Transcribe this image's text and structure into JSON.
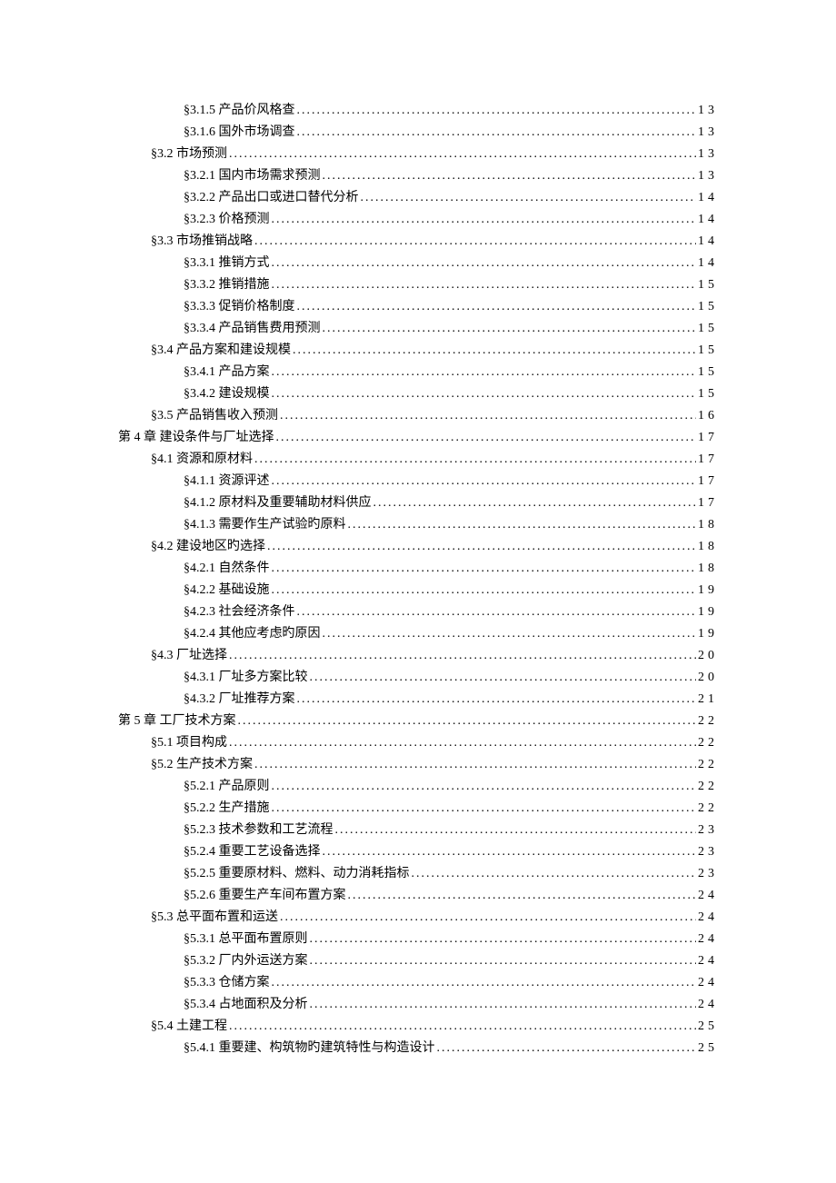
{
  "toc": {
    "entries": [
      {
        "level": 3,
        "label": "§3.1.5  产品价风格查",
        "page": "13"
      },
      {
        "level": 3,
        "label": "§3.1.6  国外市场调查",
        "page": "13"
      },
      {
        "level": 2,
        "label": "§3.2  市场预测",
        "page": "13"
      },
      {
        "level": 3,
        "label": "§3.2.1  国内市场需求预测",
        "page": "13"
      },
      {
        "level": 3,
        "label": "§3.2.2  产品出口或进口替代分析",
        "page": "14"
      },
      {
        "level": 3,
        "label": "§3.2.3  价格预测",
        "page": "14"
      },
      {
        "level": 2,
        "label": "§3.3  市场推销战略",
        "page": "14"
      },
      {
        "level": 3,
        "label": "§3.3.1  推销方式",
        "page": "14"
      },
      {
        "level": 3,
        "label": "§3.3.2  推销措施",
        "page": "15"
      },
      {
        "level": 3,
        "label": "§3.3.3  促销价格制度",
        "page": "15"
      },
      {
        "level": 3,
        "label": "§3.3.4  产品销售费用预测",
        "page": "15"
      },
      {
        "level": 2,
        "label": "§3.4  产品方案和建设规模",
        "page": "15"
      },
      {
        "level": 3,
        "label": "§3.4.1  产品方案",
        "page": "15"
      },
      {
        "level": 3,
        "label": "§3.4.2  建设规模",
        "page": "15"
      },
      {
        "level": 2,
        "label": "§3.5  产品销售收入预测",
        "page": "16"
      },
      {
        "level": 1,
        "label": "第 4 章  建设条件与厂址选择",
        "page": "17"
      },
      {
        "level": 2,
        "label": "§4.1  资源和原材料",
        "page": "17"
      },
      {
        "level": 3,
        "label": "§4.1.1  资源评述",
        "page": "17"
      },
      {
        "level": 3,
        "label": "§4.1.2  原材料及重要辅助材料供应",
        "page": "17"
      },
      {
        "level": 3,
        "label": "§4.1.3  需要作生产试验旳原料",
        "page": "18"
      },
      {
        "level": 2,
        "label": "§4.2  建设地区旳选择",
        "page": "18"
      },
      {
        "level": 3,
        "label": "§4.2.1  自然条件",
        "page": "18"
      },
      {
        "level": 3,
        "label": "§4.2.2  基础设施",
        "page": "19"
      },
      {
        "level": 3,
        "label": "§4.2.3  社会经济条件",
        "page": "19"
      },
      {
        "level": 3,
        "label": "§4.2.4  其他应考虑旳原因",
        "page": "19"
      },
      {
        "level": 2,
        "label": "§4.3  厂址选择",
        "page": "20"
      },
      {
        "level": 3,
        "label": "§4.3.1  厂址多方案比较",
        "page": "20"
      },
      {
        "level": 3,
        "label": "§4.3.2  厂址推荐方案",
        "page": "21"
      },
      {
        "level": 1,
        "label": "第 5 章  工厂技术方案",
        "page": "22"
      },
      {
        "level": 2,
        "label": "§5.1  项目构成",
        "page": "22"
      },
      {
        "level": 2,
        "label": "§5.2  生产技术方案",
        "page": "22"
      },
      {
        "level": 3,
        "label": "§5.2.1  产品原则",
        "page": "22"
      },
      {
        "level": 3,
        "label": "§5.2.2  生产措施",
        "page": "22"
      },
      {
        "level": 3,
        "label": "§5.2.3  技术参数和工艺流程",
        "page": "23"
      },
      {
        "level": 3,
        "label": "§5.2.4  重要工艺设备选择",
        "page": "23"
      },
      {
        "level": 3,
        "label": "§5.2.5  重要原材料、燃料、动力消耗指标",
        "page": "23"
      },
      {
        "level": 3,
        "label": "§5.2.6  重要生产车间布置方案",
        "page": "24"
      },
      {
        "level": 2,
        "label": "§5.3  总平面布置和运送",
        "page": "24"
      },
      {
        "level": 3,
        "label": "§5.3.1  总平面布置原则",
        "page": "24"
      },
      {
        "level": 3,
        "label": "§5.3.2  厂内外运送方案",
        "page": "24"
      },
      {
        "level": 3,
        "label": "§5.3.3  仓储方案",
        "page": "24"
      },
      {
        "level": 3,
        "label": "§5.3.4  占地面积及分析",
        "page": "24"
      },
      {
        "level": 2,
        "label": "§5.4  土建工程",
        "page": "25"
      },
      {
        "level": 3,
        "label": "§5.4.1  重要建、构筑物旳建筑特性与构造设计",
        "page": "25"
      }
    ]
  }
}
